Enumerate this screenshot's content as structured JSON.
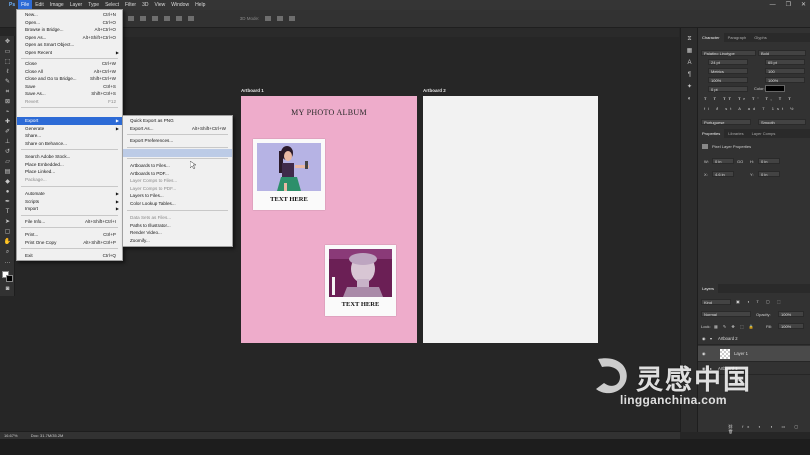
{
  "menubar": {
    "items": [
      "File",
      "Edit",
      "Image",
      "Layer",
      "Type",
      "Select",
      "Filter",
      "3D",
      "View",
      "Window",
      "Help"
    ]
  },
  "options_bar": {
    "show_transform_label": "Show Transform Controls",
    "mode_label": "3D Mode:"
  },
  "file_menu": {
    "items": [
      {
        "label": "New...",
        "shortcut": "Ctrl+N"
      },
      {
        "label": "Open...",
        "shortcut": "Ctrl+O"
      },
      {
        "label": "Browse in Bridge...",
        "shortcut": "Alt+Ctrl+O"
      },
      {
        "label": "Open As...",
        "shortcut": "Alt+Shift+Ctrl+O"
      },
      {
        "label": "Open as Smart Object...",
        "shortcut": ""
      },
      {
        "label": "Open Recent",
        "shortcut": ""
      },
      {
        "label": "Close",
        "shortcut": "Ctrl+W"
      },
      {
        "label": "Close All",
        "shortcut": "Alt+Ctrl+W"
      },
      {
        "label": "Close and Go to Bridge...",
        "shortcut": "Shift+Ctrl+W"
      },
      {
        "label": "Save",
        "shortcut": "Ctrl+S"
      },
      {
        "label": "Save As...",
        "shortcut": "Shift+Ctrl+S"
      },
      {
        "label": "Revert",
        "shortcut": "F12"
      },
      {
        "label": "Export",
        "shortcut": ""
      },
      {
        "label": "Generate",
        "shortcut": ""
      },
      {
        "label": "Share...",
        "shortcut": ""
      },
      {
        "label": "Share on Behance...",
        "shortcut": ""
      },
      {
        "label": "Search Adobe Stock...",
        "shortcut": ""
      },
      {
        "label": "Place Embedded...",
        "shortcut": ""
      },
      {
        "label": "Place Linked...",
        "shortcut": ""
      },
      {
        "label": "Package...",
        "shortcut": ""
      },
      {
        "label": "Automate",
        "shortcut": ""
      },
      {
        "label": "Scripts",
        "shortcut": ""
      },
      {
        "label": "Import",
        "shortcut": ""
      },
      {
        "label": "File Info...",
        "shortcut": "Alt+Shift+Ctrl+I"
      },
      {
        "label": "Print...",
        "shortcut": "Ctrl+P"
      },
      {
        "label": "Print One Copy",
        "shortcut": "Alt+Shift+Ctrl+P"
      },
      {
        "label": "Exit",
        "shortcut": "Ctrl+Q"
      }
    ]
  },
  "export_menu": {
    "items": [
      {
        "label": "Quick Export as PNG",
        "shortcut": ""
      },
      {
        "label": "Export As...",
        "shortcut": "Alt+Shift+Ctrl+W"
      },
      {
        "label": "Export Preferences...",
        "shortcut": ""
      },
      {
        "label": "Save for Web (Legacy)...",
        "shortcut": "Alt+Shift+Ctrl+S"
      },
      {
        "label": "Artboards to Files...",
        "shortcut": ""
      },
      {
        "label": "Artboards to PDF...",
        "shortcut": ""
      },
      {
        "label": "Layer Comps to Files...",
        "shortcut": ""
      },
      {
        "label": "Layer Comps to PDF...",
        "shortcut": ""
      },
      {
        "label": "Layers to Files...",
        "shortcut": ""
      },
      {
        "label": "Color Lookup Tables...",
        "shortcut": ""
      },
      {
        "label": "Data Sets as Files...",
        "shortcut": ""
      },
      {
        "label": "Paths to Illustrator...",
        "shortcut": ""
      },
      {
        "label": "Render Video...",
        "shortcut": ""
      },
      {
        "label": "Zoomify...",
        "shortcut": ""
      }
    ]
  },
  "artboards": {
    "ab1_label": "Artboard 1",
    "ab2_label": "Artboard 2",
    "album_title": "MY PHOTO ALBUM",
    "card1_text": "TEXT HERE",
    "card2_text": "TEXT HERE",
    "ab1_color": "#eeaccb",
    "ab2_color": "#f2f2f2"
  },
  "character_panel": {
    "tabs": [
      "Character",
      "Paragraph",
      "Glyphs"
    ],
    "font_family": "Palatino Linotype",
    "font_style": "Bold",
    "font_size": "24 pt",
    "leading": "65 pt",
    "kerning": "Metrics",
    "tracking": "100",
    "vscale": "100%",
    "hscale": "100%",
    "baseline": "0 pt",
    "color_label": "Color:",
    "language": "Portuguese",
    "antialias": "Smooth"
  },
  "properties_panel": {
    "tabs": [
      "Properties",
      "Libraries",
      "Layer Comps"
    ],
    "title": "Pixel Layer Properties",
    "w": "W:",
    "w_val": "0 in",
    "h": "H:",
    "h_val": "0 in",
    "x": "X:",
    "x_val": "4.6 in",
    "y": "Y:",
    "y_val": "0 in",
    "go_label": "GO"
  },
  "layers_panel": {
    "tab": "Layers",
    "kind": "Kind",
    "blend": "Normal",
    "opacity_label": "Opacity:",
    "opacity": "100%",
    "lock_label": "Lock:",
    "fill_label": "Fill:",
    "fill": "100%",
    "rows": [
      "Artboard 2",
      "Layer 1",
      "Artboard 1"
    ]
  },
  "statusbar": {
    "zoom": "16.67%",
    "doc": "Doc: 31.7M/35.2M"
  },
  "watermark": {
    "cn": "灵感中国",
    "en": "lingganchina.com"
  }
}
